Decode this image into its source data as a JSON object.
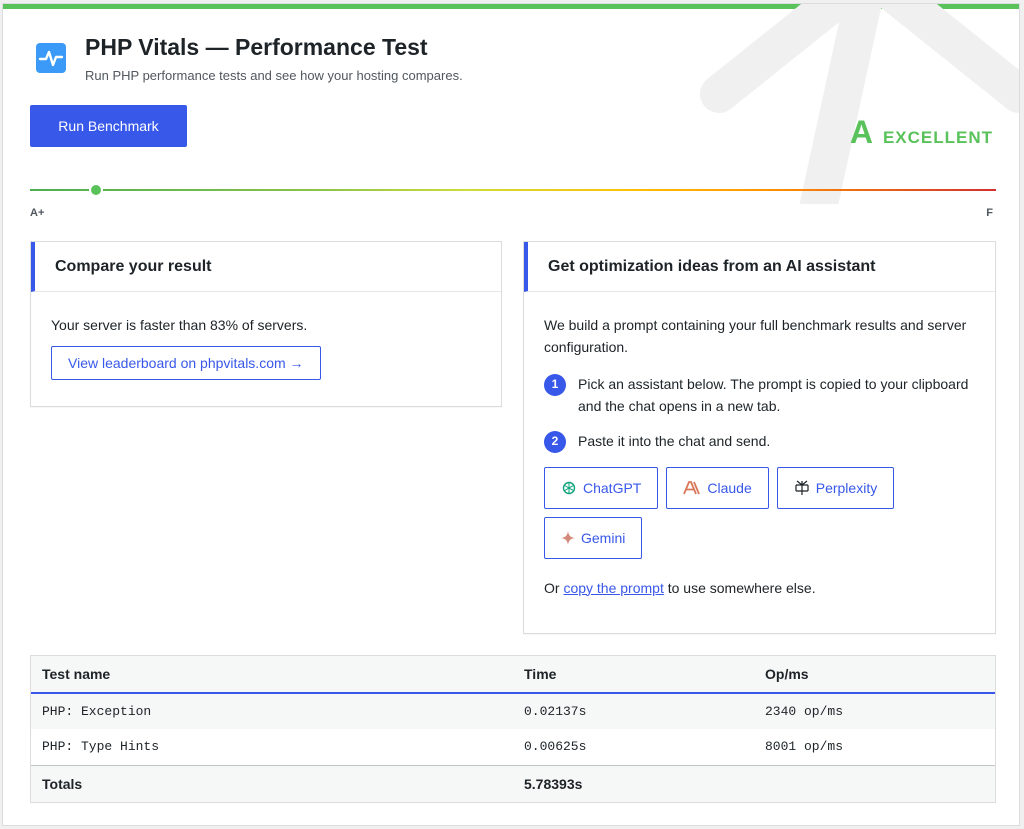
{
  "header": {
    "title": "PHP Vitals — Performance Test",
    "subtitle": "Run PHP performance tests and see how your hosting compares.",
    "run_button": "Run Benchmark"
  },
  "grade": {
    "letter": "A",
    "label": "EXCELLENT",
    "color": "#59c25a",
    "scale_start": "A+",
    "scale_end": "F"
  },
  "compare": {
    "heading": "Compare your result",
    "text": "Your server is faster than 83% of servers.",
    "leaderboard_button": "View leaderboard on phpvitals.com →"
  },
  "ai": {
    "heading": "Get optimization ideas from an AI assistant",
    "intro": "We build a prompt containing your full benchmark results and server configuration.",
    "steps": [
      {
        "num": "1",
        "text": "Pick an assistant below. The prompt is copied to your clipboard and the chat opens in a new tab."
      },
      {
        "num": "2",
        "text": "Paste it into the chat and send."
      }
    ],
    "assistants": [
      {
        "label": "ChatGPT",
        "icon": "chatgpt-icon"
      },
      {
        "label": "Claude",
        "icon": "claude-icon"
      },
      {
        "label": "Perplexity",
        "icon": "perplexity-icon"
      },
      {
        "label": "Gemini",
        "icon": "gemini-icon"
      }
    ],
    "footer_before": "Or ",
    "footer_link": "copy the prompt",
    "footer_after": " to use somewhere else."
  },
  "table": {
    "columns": [
      "Test name",
      "Time",
      "Op/ms"
    ],
    "rows": [
      [
        "PHP: Exception",
        "0.02137s",
        "2340 op/ms"
      ],
      [
        "PHP: Type Hints",
        "0.00625s",
        "8001 op/ms"
      ]
    ],
    "totals_label": "Totals",
    "totals_time": "5.78393s"
  },
  "colors": {
    "accent": "#3858e9",
    "topbar": "#59c25a"
  }
}
